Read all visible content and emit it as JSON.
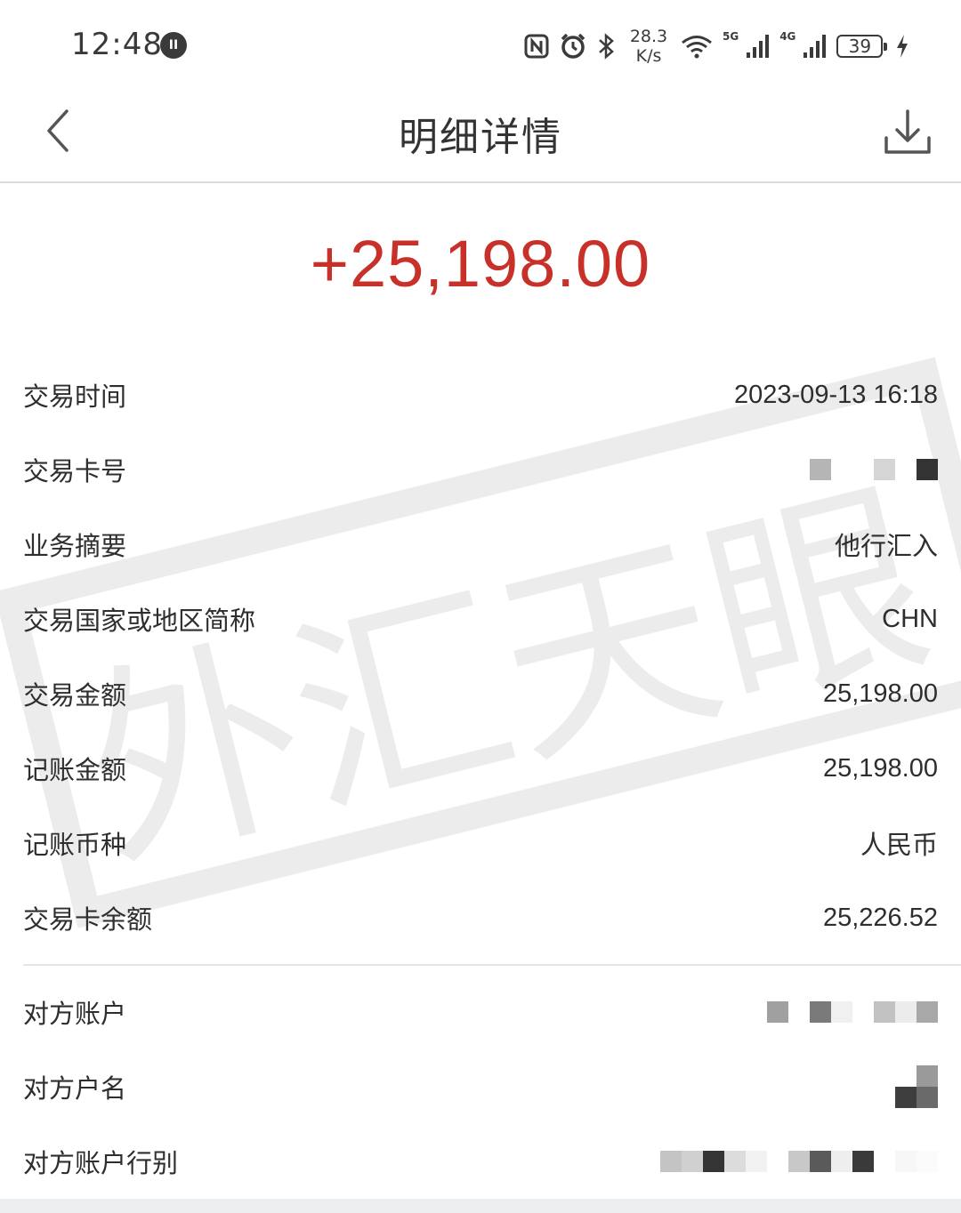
{
  "status_bar": {
    "time": "12:48",
    "network_speed_value": "28.3",
    "network_speed_unit": "K/s",
    "net1": "5G",
    "net2": "4G",
    "battery": "39",
    "icons": [
      "nfc-icon",
      "alarm-icon",
      "bluetooth-icon",
      "wifi-icon",
      "signal-icon",
      "signal-icon",
      "battery-icon",
      "charging-icon"
    ]
  },
  "header": {
    "title": "明细详情",
    "back_icon": "chevron-left-icon",
    "download_icon": "download-icon"
  },
  "amount": "+25,198.00",
  "details": [
    {
      "label": "交易时间",
      "value": "2023-09-13 16:18"
    },
    {
      "label": "交易卡号",
      "value": ""
    },
    {
      "label": "业务摘要",
      "value": "他行汇入"
    },
    {
      "label": "交易国家或地区简称",
      "value": "CHN"
    },
    {
      "label": "交易金额",
      "value": "25,198.00"
    },
    {
      "label": "记账金额",
      "value": "25,198.00"
    },
    {
      "label": "记账币种",
      "value": "人民币"
    },
    {
      "label": "交易卡余额",
      "value": "25,226.52"
    }
  ],
  "counterparty": [
    {
      "label": "对方账户",
      "value": ""
    },
    {
      "label": "对方户名",
      "value": ""
    },
    {
      "label": "对方账户行别",
      "value": ""
    }
  ],
  "colors": {
    "amount": "#c8312a",
    "text": "#2e2e2e",
    "divider": "#e6e6e6"
  },
  "watermark_text": "外汇天眼"
}
